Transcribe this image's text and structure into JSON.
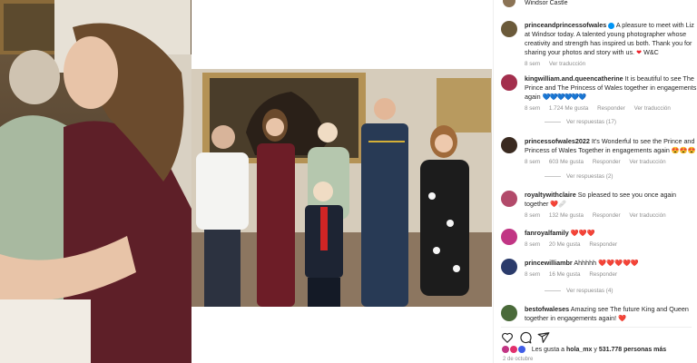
{
  "header": {
    "location": "Windsor Castle"
  },
  "caption": {
    "username": "princeandprincessofwales",
    "text": "A pleasure to meet with Liz at Windsor today. A talented young photographer whose creativity and strength has inspired us both. Thank you for sharing your photos and story with us.",
    "signoff": "W&C",
    "time": "8 sem",
    "translate": "Ver traducción"
  },
  "comments": [
    {
      "username": "kingwilliam.and.queencatherine",
      "text": "It is beautiful to see The Prince and The Princess of Wales together in engagements again",
      "emoji": "💙💙💙💙💙💙",
      "time": "8 sem",
      "likes": "1.724 Me gusta",
      "reply": "Responder",
      "translate": "Ver traducción",
      "replies": "Ver respuestas (17)"
    },
    {
      "username": "princessofwales2022",
      "text": "It's Wonderful to see the Prince and Princess of Wales Together in engagements again",
      "emoji": "😍😍😍",
      "time": "8 sem",
      "likes": "603 Me gusta",
      "reply": "Responder",
      "translate": "Ver traducción",
      "replies": "Ver respuestas (2)"
    },
    {
      "username": "royaltywithclaire",
      "text": "So pleased to see you once again together",
      "emoji": "❤️🩹",
      "time": "8 sem",
      "likes": "132 Me gusta",
      "reply": "Responder",
      "translate": "Ver traducción",
      "replies": ""
    },
    {
      "username": "fanroyalfamily",
      "text": "",
      "emoji": "❤️❤️❤️",
      "time": "8 sem",
      "likes": "20 Me gusta",
      "reply": "Responder",
      "translate": "",
      "replies": ""
    },
    {
      "username": "princewilliambr",
      "text": "Ahhhhh",
      "emoji": "❤️❤️❤️❤️❤️",
      "time": "8 sem",
      "likes": "16 Me gusta",
      "reply": "Responder",
      "translate": "",
      "replies": "Ver respuestas (4)"
    },
    {
      "username": "bestofwaleses",
      "text": "Amazing see The future King and Queen together in engagements again!",
      "emoji": "❤️",
      "time": "",
      "likes": "",
      "reply": "",
      "translate": "",
      "replies": ""
    }
  ],
  "likes": {
    "prefix": "Les gusta a",
    "user": "hola_mx",
    "middle": "y",
    "count": "531.778",
    "suffix": "personas más"
  },
  "date": "2 de octubre",
  "colors": {
    "accent": "#0095f6",
    "heart": "#ed1c24",
    "muted": "#8e8e8e"
  },
  "icons": [
    "heart-icon",
    "comment-icon",
    "share-icon"
  ]
}
